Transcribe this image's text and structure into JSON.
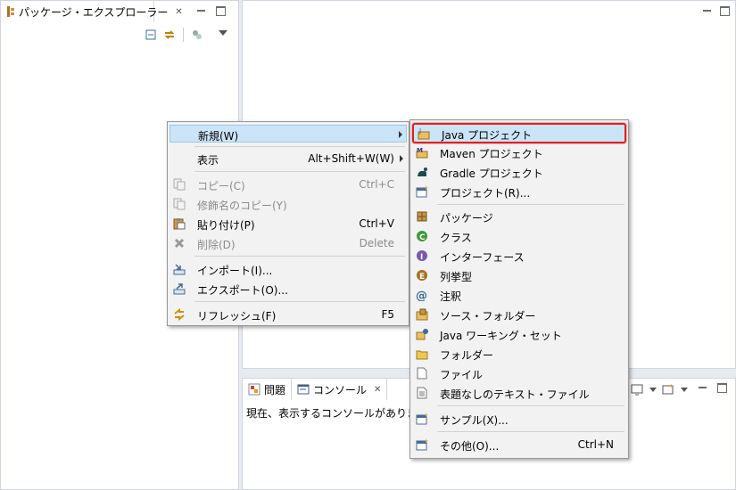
{
  "package_explorer": {
    "title": "パッケージ・エクスプローラー"
  },
  "console_view": {
    "tabs": [
      {
        "label": "問題"
      },
      {
        "label": "コンソール"
      }
    ],
    "message": "現在、表示するコンソールがありません。"
  },
  "context_menu": {
    "items": [
      {
        "label": "新規(W)",
        "shortcut": "",
        "submenu": true,
        "enabled": true,
        "icon": "none"
      },
      {
        "label": "表示",
        "shortcut": "Alt+Shift+W(W)",
        "submenu": true,
        "enabled": true,
        "icon": "none"
      },
      {
        "label": "コピー(C)",
        "shortcut": "Ctrl+C",
        "submenu": false,
        "enabled": false,
        "icon": "copy-icon"
      },
      {
        "label": "修飾名のコピー(Y)",
        "shortcut": "",
        "submenu": false,
        "enabled": false,
        "icon": "copy-qualified-name-icon"
      },
      {
        "label": "貼り付け(P)",
        "shortcut": "Ctrl+V",
        "submenu": false,
        "enabled": true,
        "icon": "paste-icon"
      },
      {
        "label": "削除(D)",
        "shortcut": "Delete",
        "submenu": false,
        "enabled": false,
        "icon": "delete-icon"
      },
      {
        "label": "インポート(I)...",
        "shortcut": "",
        "submenu": false,
        "enabled": true,
        "icon": "import-icon"
      },
      {
        "label": "エクスポート(O)...",
        "shortcut": "",
        "submenu": false,
        "enabled": true,
        "icon": "export-icon"
      },
      {
        "label": "リフレッシュ(F)",
        "shortcut": "F5",
        "submenu": false,
        "enabled": true,
        "icon": "refresh-icon"
      }
    ]
  },
  "new_submenu": {
    "items": [
      {
        "label": "Java プロジェクト",
        "shortcut": "",
        "icon": "java-project-icon"
      },
      {
        "label": "Maven プロジェクト",
        "shortcut": "",
        "icon": "maven-project-icon"
      },
      {
        "label": "Gradle プロジェクト",
        "shortcut": "",
        "icon": "gradle-project-icon"
      },
      {
        "label": "プロジェクト(R)...",
        "shortcut": "",
        "icon": "project-icon"
      },
      {
        "label": "パッケージ",
        "shortcut": "",
        "icon": "package-icon"
      },
      {
        "label": "クラス",
        "shortcut": "",
        "icon": "class-icon"
      },
      {
        "label": "インターフェース",
        "shortcut": "",
        "icon": "interface-icon"
      },
      {
        "label": "列挙型",
        "shortcut": "",
        "icon": "enum-icon"
      },
      {
        "label": "注釈",
        "shortcut": "",
        "icon": "annotation-icon"
      },
      {
        "label": "ソース・フォルダー",
        "shortcut": "",
        "icon": "source-folder-icon"
      },
      {
        "label": "Java ワーキング・セット",
        "shortcut": "",
        "icon": "working-set-icon"
      },
      {
        "label": "フォルダー",
        "shortcut": "",
        "icon": "folder-icon"
      },
      {
        "label": "ファイル",
        "shortcut": "",
        "icon": "file-icon"
      },
      {
        "label": "表題なしのテキスト・ファイル",
        "shortcut": "",
        "icon": "untitled-text-file-icon"
      },
      {
        "label": "サンプル(X)...",
        "shortcut": "",
        "icon": "example-icon"
      },
      {
        "label": "その他(O)...",
        "shortcut": "Ctrl+N",
        "icon": "other-wizard-icon"
      }
    ]
  },
  "colors": {
    "accent": "#cce4f7",
    "selection_outline": "#e02020"
  }
}
